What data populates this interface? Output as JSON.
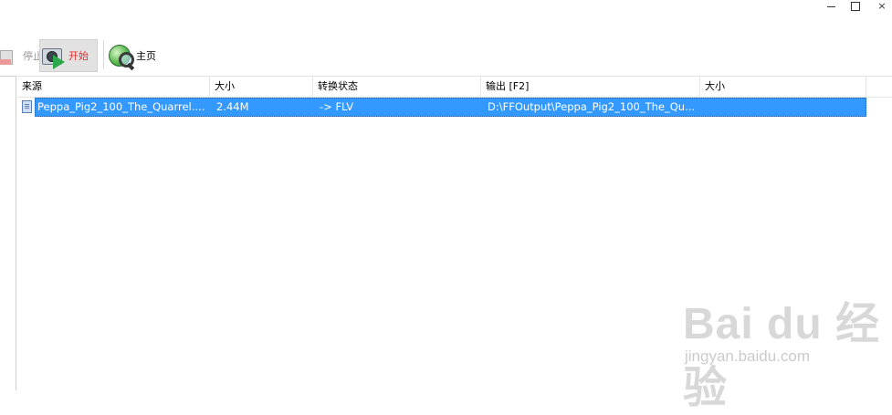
{
  "window": {
    "minimize_icon": "minimize-icon",
    "maximize_icon": "maximize-icon",
    "close_glyph": "×"
  },
  "toolbar": {
    "stop_label": "停止",
    "start_label": "开始",
    "home_label": "主页"
  },
  "columns": [
    "来源",
    "大小",
    "转换状态",
    "输出 [F2]",
    "大小"
  ],
  "rows": [
    {
      "source": "Peppa_Pig2_100_The_Quarrel....",
      "size": "2.44M",
      "status": "-> FLV",
      "output": "D:\\FFOutput\\Peppa_Pig2_100_The_Qu...",
      "out_size": ""
    }
  ],
  "watermark": {
    "logo": "Bai du 经验",
    "url": "jingyan.baidu.com"
  },
  "colors": {
    "selection": "#3399ff",
    "start_label": "#e23030",
    "stop_label": "#9a9a9a"
  }
}
